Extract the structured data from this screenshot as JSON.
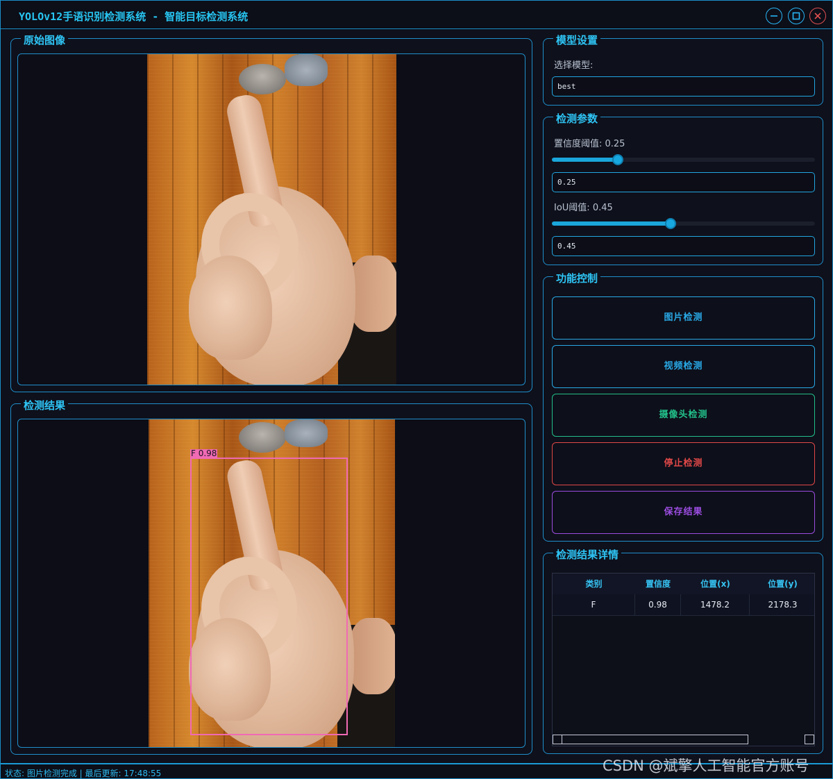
{
  "window": {
    "title": "YOLOv12手语识别检测系统 - 智能目标检测系统",
    "controls": [
      "minimize-icon",
      "maximize-icon",
      "close-icon"
    ]
  },
  "original_panel": {
    "title": "原始图像"
  },
  "result_panel": {
    "title": "检测结果",
    "detection_label": "F 0.98"
  },
  "model_settings": {
    "title": "模型设置",
    "select_label": "选择模型:",
    "selected_model": "best"
  },
  "detect_params": {
    "title": "检测参数",
    "conf_label": "置信度阈值: 0.25",
    "conf_value": "0.25",
    "conf_fraction": 0.25,
    "iou_label": "IoU阈值: 0.45",
    "iou_value": "0.45",
    "iou_fraction": 0.45
  },
  "function_control": {
    "title": "功能控制",
    "buttons": [
      {
        "label": "图片检测",
        "color": "#29a9e6"
      },
      {
        "label": "视频检测",
        "color": "#29a9e6"
      },
      {
        "label": "摄像头检测",
        "color": "#22c08a"
      },
      {
        "label": "停止检测",
        "color": "#e04848"
      },
      {
        "label": "保存结果",
        "color": "#9b4de0"
      }
    ]
  },
  "results_detail": {
    "title": "检测结果详情",
    "columns": [
      "类别",
      "置信度",
      "位置(x)",
      "位置(y)"
    ],
    "rows": [
      [
        "F",
        "0.98",
        "1478.2",
        "2178.3"
      ]
    ]
  },
  "status_bar": {
    "text": "状态: 图片检测完成 | 最后更新: 17:48:55"
  },
  "watermark": "CSDN @斌擎人工智能官方账号"
}
